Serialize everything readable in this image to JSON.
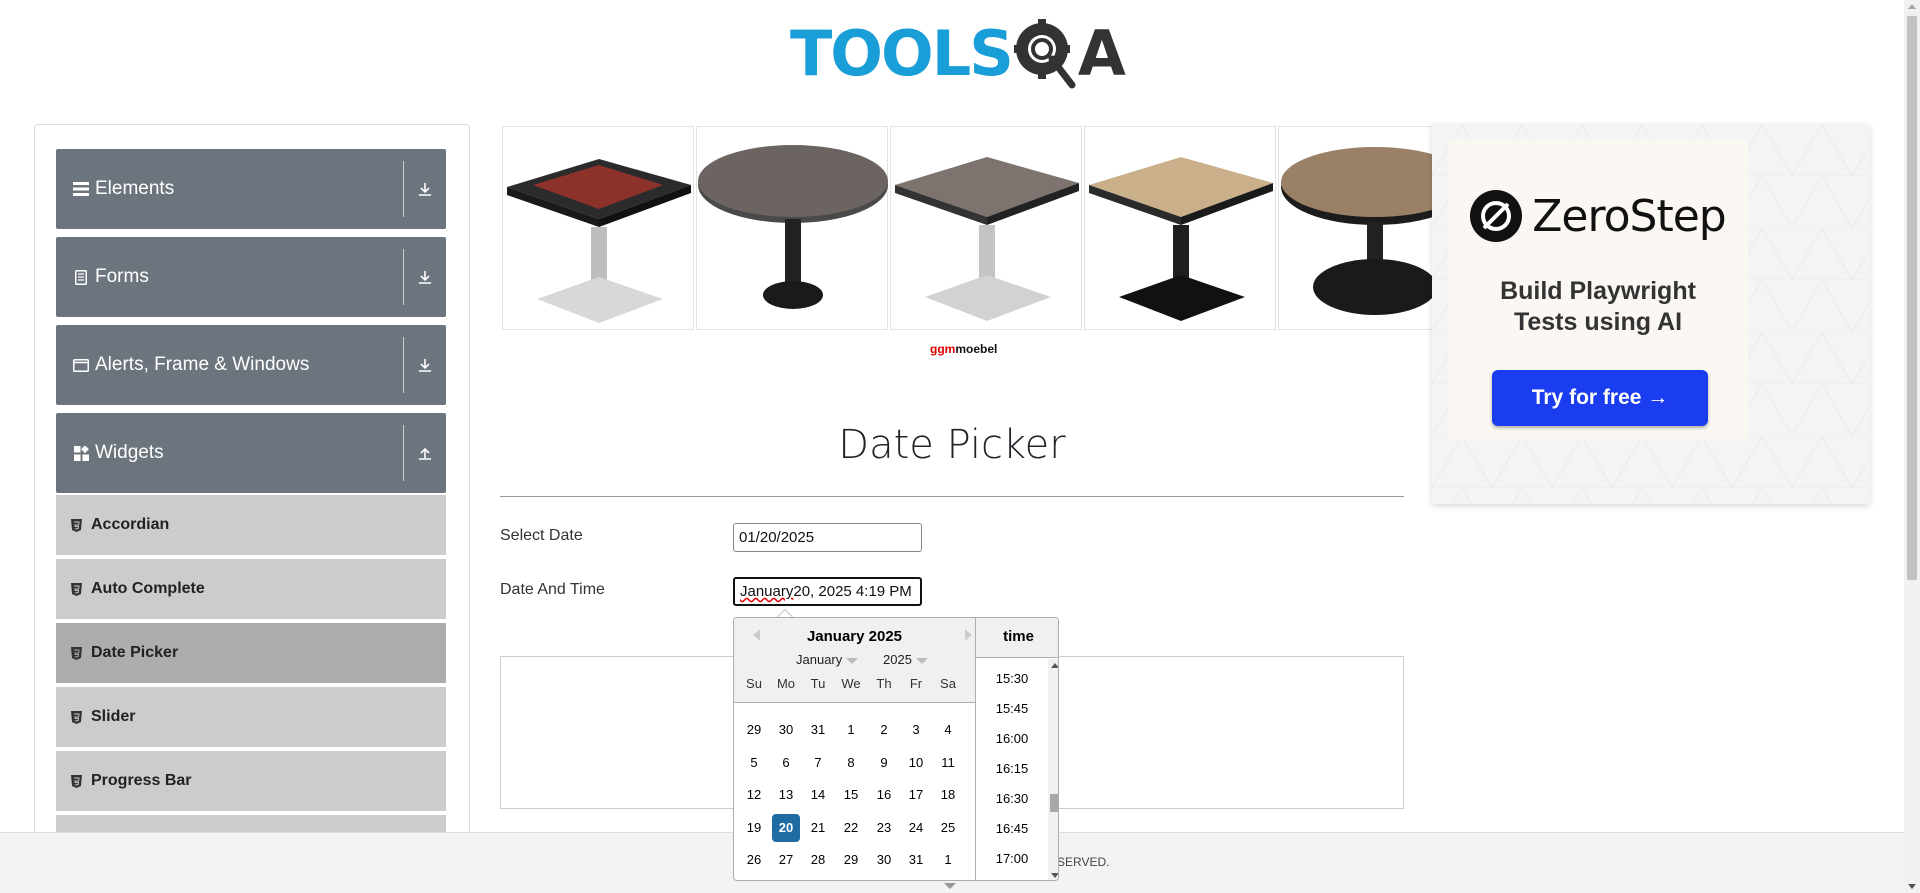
{
  "header": {
    "logo_part1": "TOOLS",
    "logo_part2": "A"
  },
  "sidebar": {
    "groups": [
      {
        "label": "Elements",
        "icon": "hamburger-icon"
      },
      {
        "label": "Forms",
        "icon": "form-icon"
      },
      {
        "label": "Alerts, Frame & Windows",
        "icon": "window-icon"
      },
      {
        "label": "Widgets",
        "icon": "widgets-icon"
      }
    ],
    "items": [
      {
        "label": "Accordian"
      },
      {
        "label": "Auto Complete"
      },
      {
        "label": "Date Picker"
      },
      {
        "label": "Slider"
      },
      {
        "label": "Progress Bar"
      }
    ]
  },
  "banner": {
    "brand_red": "ggm",
    "brand_black": "moebel"
  },
  "main": {
    "title": "Date Picker",
    "select_date_label": "Select Date",
    "select_date_value": "01/20/2025",
    "date_time_label": "Date And Time",
    "date_time_value_a": "January",
    "date_time_value_b": " 20, 2025 4:19 PM"
  },
  "ad": {
    "brand": "ZeroStep",
    "tagline_line1": "Build Playwright",
    "tagline_line2": "Tests using AI",
    "cta": "Try for free →"
  },
  "footer": {
    "text": "SERVED."
  },
  "datepicker": {
    "month_title": "January 2025",
    "month_select": "January",
    "year_select": "2025",
    "day_names": [
      "Su",
      "Mo",
      "Tu",
      "We",
      "Th",
      "Fr",
      "Sa"
    ],
    "weeks": [
      [
        "29",
        "30",
        "31",
        "1",
        "2",
        "3",
        "4"
      ],
      [
        "5",
        "6",
        "7",
        "8",
        "9",
        "10",
        "11"
      ],
      [
        "12",
        "13",
        "14",
        "15",
        "16",
        "17",
        "18"
      ],
      [
        "19",
        "20",
        "21",
        "22",
        "23",
        "24",
        "25"
      ],
      [
        "26",
        "27",
        "28",
        "29",
        "30",
        "31",
        "1"
      ]
    ],
    "selected_day": "20",
    "time_header": "time",
    "times": [
      "15:30",
      "15:45",
      "16:00",
      "16:15",
      "16:30",
      "16:45",
      "17:00"
    ]
  },
  "colors": {
    "logo_blue": "#1a9ed8",
    "sidebar_group": "#6c757d",
    "sidebar_item": "#cccccc",
    "sidebar_item_active": "#adadad",
    "selected_day": "#216ba5",
    "cta_blue": "#1a3df0"
  }
}
